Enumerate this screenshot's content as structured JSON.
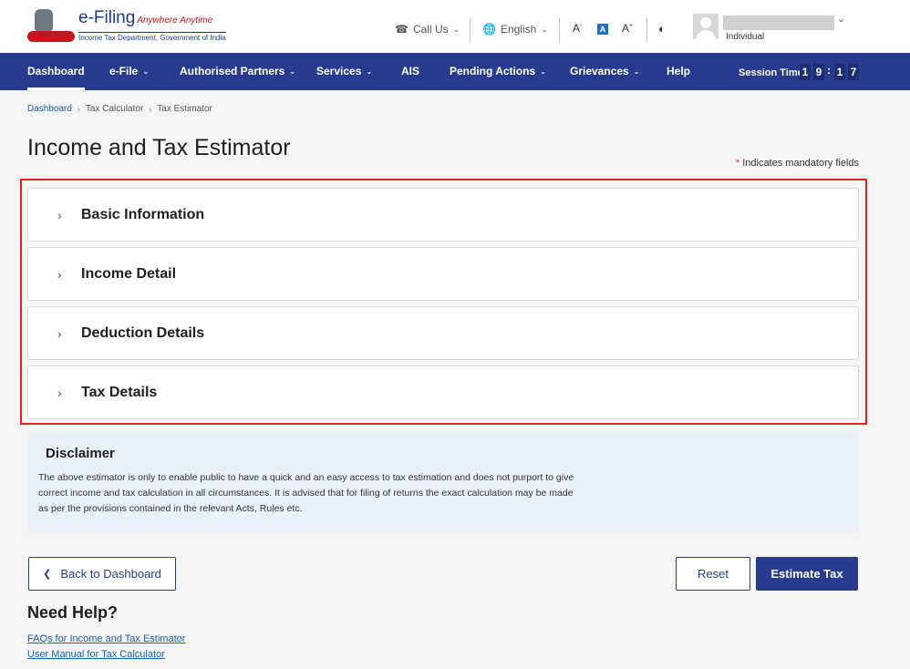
{
  "header": {
    "logo_title": "e-Filing",
    "logo_tagline": "Anywhere Anytime",
    "logo_subtitle": "Income Tax Department, Government of India",
    "call_us": "Call Us",
    "language": "English",
    "font_decrease": "A",
    "font_normal": "A",
    "font_increase": "A",
    "user_role": "Individual"
  },
  "nav": {
    "items": [
      "Dashboard",
      "e-File",
      "Authorised Partners",
      "Services",
      "AIS",
      "Pending Actions",
      "Grievances",
      "Help"
    ],
    "session_label": "Session Time",
    "session_digits": [
      "1",
      "9",
      "1",
      "7"
    ]
  },
  "breadcrumb": [
    "Dashboard",
    "Tax Calculator",
    "Tax Estimator"
  ],
  "page": {
    "title": "Income and Tax Estimator",
    "mandatory_note": "Indicates mandatory fields"
  },
  "sections": [
    "Basic Information",
    "Income Detail",
    "Deduction Details",
    "Tax Details"
  ],
  "disclaimer": {
    "title": "Disclaimer",
    "text": "The above estimator is only to enable public to have a quick and an easy access to tax estimation and does not purport to give correct income and tax calculation in all circumstances. It is advised that for filing of returns the exact calculation may be made as per the provisions contained in the relevant Acts, Rules etc."
  },
  "actions": {
    "back": "Back to Dashboard",
    "reset": "Reset",
    "estimate": "Estimate Tax"
  },
  "help": {
    "title": "Need Help?",
    "links": [
      "FAQs for Income and Tax Estimator",
      "User Manual for Tax Calculator"
    ]
  },
  "colors": {
    "brand": "#293b8e",
    "highlight": "#e31e24",
    "disclaimer_bg": "#eaf1fb"
  }
}
